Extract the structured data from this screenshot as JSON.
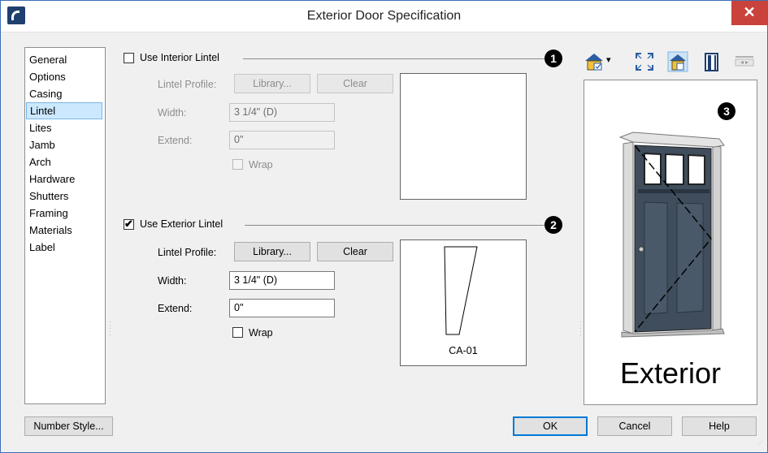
{
  "window": {
    "title": "Exterior Door Specification",
    "close_glyph": "✕"
  },
  "sidebar": {
    "items": [
      {
        "label": "General"
      },
      {
        "label": "Options"
      },
      {
        "label": "Casing"
      },
      {
        "label": "Lintel"
      },
      {
        "label": "Lites"
      },
      {
        "label": "Jamb"
      },
      {
        "label": "Arch"
      },
      {
        "label": "Hardware"
      },
      {
        "label": "Shutters"
      },
      {
        "label": "Framing"
      },
      {
        "label": "Materials"
      },
      {
        "label": "Label"
      }
    ],
    "selected": "Lintel"
  },
  "interior": {
    "checkbox_label": "Use Interior Lintel",
    "checked": false,
    "callout": "1",
    "profile_label": "Lintel Profile:",
    "library_button": "Library...",
    "clear_button": "Clear",
    "width_label": "Width:",
    "width_value": "3 1/4\" (D)",
    "extend_label": "Extend:",
    "extend_value": "0\"",
    "wrap_label": "Wrap",
    "wrap_checked": false
  },
  "exterior": {
    "checkbox_label": "Use Exterior Lintel",
    "checked": true,
    "callout": "2",
    "profile_label": "Lintel Profile:",
    "library_button": "Library...",
    "clear_button": "Clear",
    "width_label": "Width:",
    "width_value": "3 1/4\" (D)",
    "extend_label": "Extend:",
    "extend_value": "0\"",
    "wrap_label": "Wrap",
    "wrap_checked": false,
    "profile_name": "CA-01",
    "check_glyph": "✔"
  },
  "preview3d": {
    "callout": "3",
    "caption": "Exterior"
  },
  "toolbar": {
    "icons": [
      "view-type-icon",
      "fit-window-icon",
      "camera-settings-icon",
      "door-elevation-icon",
      "swap-side-icon"
    ],
    "dropdown_glyph": "▾"
  },
  "footer": {
    "number_style_button": "Number Style...",
    "ok_button": "OK",
    "cancel_button": "Cancel",
    "help_button": "Help"
  },
  "colors": {
    "accent": "#3a6fb7",
    "close": "#c9433c",
    "selection": "#cce8ff",
    "door": "#3f4d5c"
  }
}
